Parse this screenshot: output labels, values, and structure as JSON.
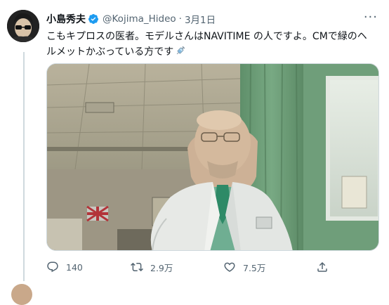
{
  "tweet": {
    "display_name": "小島秀夫",
    "handle": "@Kojima_Hideo",
    "separator": "·",
    "date": "3月1日",
    "more_label": "···",
    "text": "こもキプロスの医者。モデルさんはNAVITIME の人ですよ。CMで緑のヘルメットかぶっている方です",
    "text_emoji": "syringe-icon",
    "image_alt": "白衣を着た男性が病院の一室に立っている写真"
  },
  "actions": {
    "reply_count": "140",
    "retweet_count": "2.9万",
    "like_count": "7.5万"
  },
  "colors": {
    "text_primary": "#0f1419",
    "text_secondary": "#536471",
    "verified_blue": "#1d9bf0",
    "thread_line": "#cfd9de"
  }
}
